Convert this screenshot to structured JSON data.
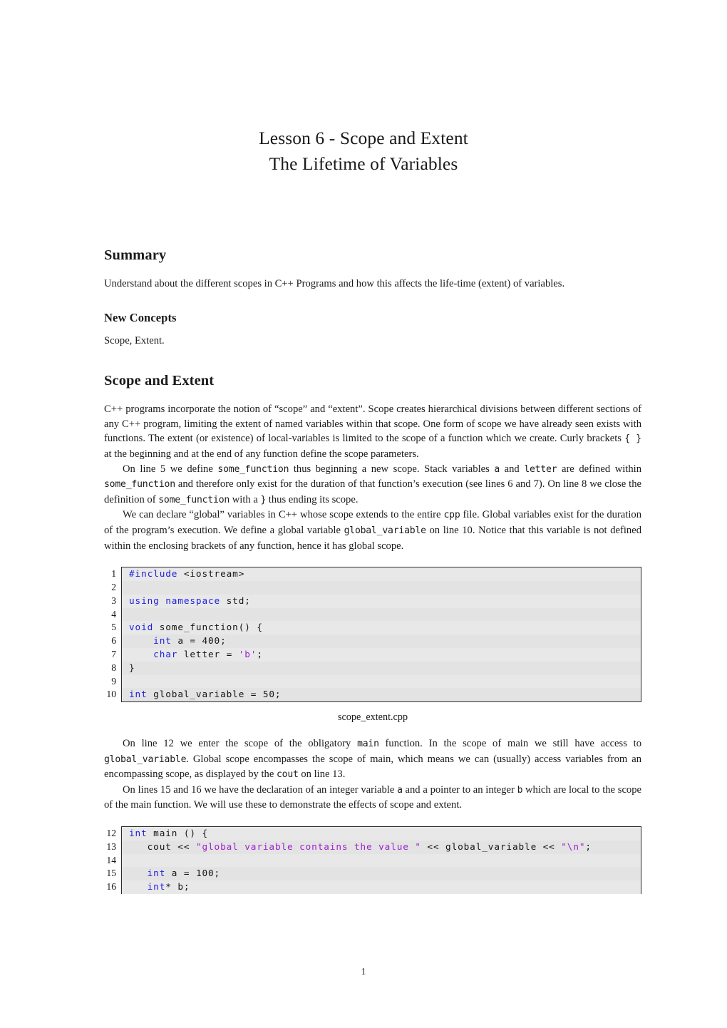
{
  "document": {
    "title_lines": [
      "Lesson 6 - Scope and Extent",
      "The Lifetime of Variables"
    ],
    "page_number": "1"
  },
  "summary": {
    "heading": "Summary",
    "text": "Understand about the different scopes in C++ Programs and how this affects the life-time (extent) of variables.",
    "new_concepts_heading": "New Concepts",
    "new_concepts_text": "Scope, Extent."
  },
  "scope_section": {
    "heading": "Scope and Extent",
    "para1_a": "C++ programs incorporate the notion of “scope” and “extent”. Scope creates hierarchical divisions between different sections of any C++ program, limiting the extent of named variables within that scope. One form of scope we have already seen exists with functions. The extent (or existence) of local-variables is limited to the scope of a function which we create. Curly brackets ",
    "para1_code1": "{ }",
    "para1_b": " at the beginning and at the end of any function define the scope parameters.",
    "para2_a": "On line 5 we define ",
    "para2_code1": "some_function",
    "para2_b": " thus beginning a new scope. Stack variables ",
    "para2_code2": "a",
    "para2_c": " and ",
    "para2_code3": "letter",
    "para2_d": " are defined within ",
    "para2_code4": "some_function",
    "para2_e": " and therefore only exist for the duration of that function’s execution (see lines 6 and 7). On line 8 we close the definition of ",
    "para2_code5": "some_function",
    "para2_f": " with a ",
    "para2_code6": "}",
    "para2_g": " thus ending its scope.",
    "para3_a": "We can declare “global” variables in C++ whose scope extends to the entire ",
    "para3_code1": "cpp",
    "para3_b": " file. Global variables exist for the duration of the program’s execution. We define a global variable ",
    "para3_code2": "global_variable",
    "para3_c": " on line 10. Notice that this variable is not defined within the enclosing brackets of any function, hence it has global scope.",
    "para4_a": "On line 12 we enter the scope of the obligatory ",
    "para4_code1": "main",
    "para4_b": " function. In the scope of main we still have access to ",
    "para4_code2": "global_variable",
    "para4_c": ". Global scope encompasses the scope of main, which means we can (usually) access variables from an encompassing scope, as displayed by the ",
    "para4_code3": "cout",
    "para4_d": " on line 13.",
    "para5_a": "On lines 15 and 16 we have the declaration of an integer variable ",
    "para5_code1": "a",
    "para5_b": " and a pointer to an integer ",
    "para5_code2": "b",
    "para5_c": " which are local to the scope of the main function. We will use these to demonstrate the effects of scope and extent."
  },
  "listing1": {
    "caption": "scope_extent.cpp",
    "lines": [
      {
        "n": "1",
        "segments": [
          {
            "t": "#include ",
            "c": "kw"
          },
          {
            "t": "<iostream>",
            "c": ""
          }
        ]
      },
      {
        "n": "2",
        "segments": [
          {
            "t": "",
            "c": ""
          }
        ]
      },
      {
        "n": "3",
        "segments": [
          {
            "t": "using namespace ",
            "c": "kw"
          },
          {
            "t": "std;",
            "c": ""
          }
        ]
      },
      {
        "n": "4",
        "segments": [
          {
            "t": "",
            "c": ""
          }
        ]
      },
      {
        "n": "5",
        "segments": [
          {
            "t": "void ",
            "c": "kw"
          },
          {
            "t": "some_function() {",
            "c": ""
          }
        ]
      },
      {
        "n": "6",
        "segments": [
          {
            "t": "    ",
            "c": ""
          },
          {
            "t": "int",
            "c": "kw"
          },
          {
            "t": " a = 400;",
            "c": ""
          }
        ]
      },
      {
        "n": "7",
        "segments": [
          {
            "t": "    ",
            "c": ""
          },
          {
            "t": "char",
            "c": "kw"
          },
          {
            "t": " letter = ",
            "c": ""
          },
          {
            "t": "'b'",
            "c": "str"
          },
          {
            "t": ";",
            "c": ""
          }
        ]
      },
      {
        "n": "8",
        "segments": [
          {
            "t": "}",
            "c": ""
          }
        ]
      },
      {
        "n": "9",
        "segments": [
          {
            "t": "",
            "c": ""
          }
        ]
      },
      {
        "n": "10",
        "segments": [
          {
            "t": "int",
            "c": "kw"
          },
          {
            "t": " global_variable = 50;",
            "c": ""
          }
        ]
      }
    ]
  },
  "listing2": {
    "lines": [
      {
        "n": "12",
        "segments": [
          {
            "t": "int",
            "c": "kw"
          },
          {
            "t": " main () {",
            "c": ""
          }
        ]
      },
      {
        "n": "13",
        "segments": [
          {
            "t": "   cout << ",
            "c": ""
          },
          {
            "t": "\"global variable contains the value \"",
            "c": "str"
          },
          {
            "t": " << global_variable << ",
            "c": ""
          },
          {
            "t": "\"\\n\"",
            "c": "str"
          },
          {
            "t": ";",
            "c": ""
          }
        ]
      },
      {
        "n": "14",
        "segments": [
          {
            "t": "",
            "c": ""
          }
        ]
      },
      {
        "n": "15",
        "segments": [
          {
            "t": "   ",
            "c": ""
          },
          {
            "t": "int",
            "c": "kw"
          },
          {
            "t": " a = 100;",
            "c": ""
          }
        ]
      },
      {
        "n": "16",
        "segments": [
          {
            "t": "   ",
            "c": ""
          },
          {
            "t": "int",
            "c": "kw"
          },
          {
            "t": "* b;",
            "c": ""
          }
        ]
      }
    ]
  }
}
